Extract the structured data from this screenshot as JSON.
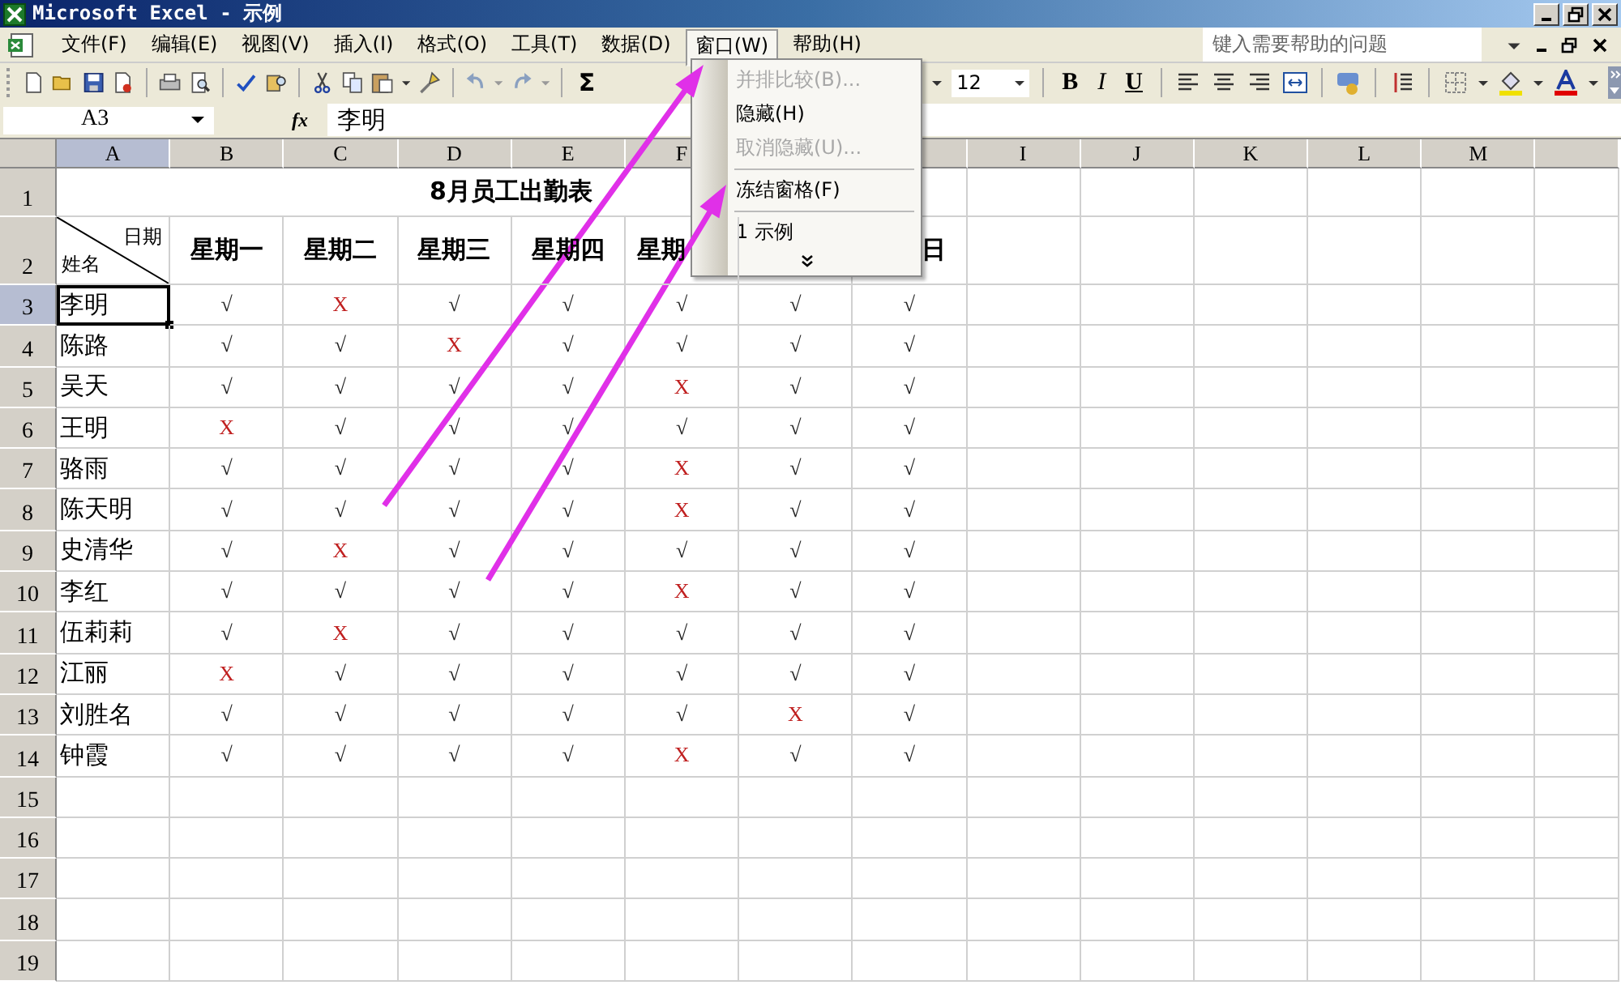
{
  "window": {
    "title": "Microsoft Excel - 示例"
  },
  "menu_bar": [
    {
      "label": "文件(F)",
      "selected": false
    },
    {
      "label": "编辑(E)",
      "selected": false
    },
    {
      "label": "视图(V)",
      "selected": false
    },
    {
      "label": "插入(I)",
      "selected": false
    },
    {
      "label": "格式(O)",
      "selected": false
    },
    {
      "label": "工具(T)",
      "selected": false
    },
    {
      "label": "数据(D)",
      "selected": false
    },
    {
      "label": "窗口(W)",
      "selected": true
    },
    {
      "label": "帮助(H)",
      "selected": false
    }
  ],
  "help_box": {
    "placeholder": "键入需要帮助的问题"
  },
  "toolbar": {
    "sum": "Σ",
    "font_size": "12",
    "bold": "B",
    "italic": "I",
    "underline": "U"
  },
  "formula_bar": {
    "name_box": "A3",
    "fx": "fx",
    "value": "李明"
  },
  "window_menu": [
    {
      "kind": "item",
      "label": "并排比较(B)...",
      "disabled": true
    },
    {
      "kind": "item",
      "label": "隐藏(H)",
      "disabled": false
    },
    {
      "kind": "item",
      "label": "取消隐藏(U)...",
      "disabled": true
    },
    {
      "kind": "separator"
    },
    {
      "kind": "item",
      "label": "冻结窗格(F)",
      "disabled": false
    },
    {
      "kind": "separator"
    },
    {
      "kind": "item",
      "label": "1 示例",
      "disabled": false
    },
    {
      "kind": "expand"
    }
  ],
  "column_headers_left": [
    {
      "label": "A",
      "selected": true
    },
    {
      "label": "B",
      "selected": false
    },
    {
      "label": "C",
      "selected": false
    },
    {
      "label": "D",
      "selected": false
    },
    {
      "label": "E",
      "selected": false
    },
    {
      "label": "F",
      "selected": false
    }
  ],
  "column_headers_right": [
    {
      "label": "I",
      "selected": false
    },
    {
      "label": "J",
      "selected": false
    },
    {
      "label": "K",
      "selected": false
    },
    {
      "label": "L",
      "selected": false
    },
    {
      "label": "M",
      "selected": false
    }
  ],
  "row_headers": [
    {
      "label": "1",
      "selected": false
    },
    {
      "label": "2",
      "selected": false
    },
    {
      "label": "3",
      "selected": true
    },
    {
      "label": "4",
      "selected": false
    },
    {
      "label": "5",
      "selected": false
    },
    {
      "label": "6",
      "selected": false
    },
    {
      "label": "7",
      "selected": false
    },
    {
      "label": "8",
      "selected": false
    },
    {
      "label": "9",
      "selected": false
    },
    {
      "label": "10",
      "selected": false
    },
    {
      "label": "11",
      "selected": false
    },
    {
      "label": "12",
      "selected": false
    },
    {
      "label": "13",
      "selected": false
    },
    {
      "label": "14",
      "selected": false
    },
    {
      "label": "15",
      "selected": false
    },
    {
      "label": "16",
      "selected": false
    },
    {
      "label": "17",
      "selected": false
    },
    {
      "label": "18",
      "selected": false
    },
    {
      "label": "19",
      "selected": false
    }
  ],
  "sheet": {
    "title": "8月员工出勤表",
    "corner_top": "日期",
    "corner_bottom": "姓名",
    "day_headers": [
      {
        "text": "星期一",
        "kind": "full"
      },
      {
        "text": "星期二",
        "kind": "full"
      },
      {
        "text": "星期三",
        "kind": "full"
      },
      {
        "text": "星期四",
        "kind": "full"
      },
      {
        "text": "星期",
        "kind": "cut_end"
      },
      {
        "kind": "hidden"
      },
      {
        "text": "日",
        "kind": "cut_start"
      }
    ],
    "rows": [
      {
        "name": "李明",
        "selected": true,
        "marks": [
          {
            "text": "√",
            "kind": "present"
          },
          {
            "text": "X",
            "kind": "absent"
          },
          {
            "text": "√",
            "kind": "present"
          },
          {
            "text": "√",
            "kind": "present"
          },
          {
            "text": "√",
            "kind": "present"
          },
          {
            "text": "√",
            "kind": "present"
          },
          {
            "text": "√",
            "kind": "present"
          }
        ]
      },
      {
        "name": "陈路",
        "selected": false,
        "marks": [
          {
            "text": "√",
            "kind": "present"
          },
          {
            "text": "√",
            "kind": "present"
          },
          {
            "text": "X",
            "kind": "absent"
          },
          {
            "text": "√",
            "kind": "present"
          },
          {
            "text": "√",
            "kind": "present"
          },
          {
            "text": "√",
            "kind": "present"
          },
          {
            "text": "√",
            "kind": "present"
          }
        ]
      },
      {
        "name": "吴天",
        "selected": false,
        "marks": [
          {
            "text": "√",
            "kind": "present"
          },
          {
            "text": "√",
            "kind": "present"
          },
          {
            "text": "√",
            "kind": "present"
          },
          {
            "text": "√",
            "kind": "present"
          },
          {
            "text": "X",
            "kind": "absent"
          },
          {
            "text": "√",
            "kind": "present"
          },
          {
            "text": "√",
            "kind": "present"
          }
        ]
      },
      {
        "name": "王明",
        "selected": false,
        "marks": [
          {
            "text": "X",
            "kind": "absent"
          },
          {
            "text": "√",
            "kind": "present"
          },
          {
            "text": "√",
            "kind": "present"
          },
          {
            "text": "√",
            "kind": "present"
          },
          {
            "text": "√",
            "kind": "present"
          },
          {
            "text": "√",
            "kind": "present"
          },
          {
            "text": "√",
            "kind": "present"
          }
        ]
      },
      {
        "name": "骆雨",
        "selected": false,
        "marks": [
          {
            "text": "√",
            "kind": "present"
          },
          {
            "text": "√",
            "kind": "present"
          },
          {
            "text": "√",
            "kind": "present"
          },
          {
            "text": "√",
            "kind": "present"
          },
          {
            "text": "X",
            "kind": "absent"
          },
          {
            "text": "√",
            "kind": "present"
          },
          {
            "text": "√",
            "kind": "present"
          }
        ]
      },
      {
        "name": "陈天明",
        "selected": false,
        "marks": [
          {
            "text": "√",
            "kind": "present"
          },
          {
            "text": "√",
            "kind": "present"
          },
          {
            "text": "√",
            "kind": "present"
          },
          {
            "text": "√",
            "kind": "present"
          },
          {
            "text": "X",
            "kind": "absent"
          },
          {
            "text": "√",
            "kind": "present"
          },
          {
            "text": "√",
            "kind": "present"
          }
        ]
      },
      {
        "name": "史清华",
        "selected": false,
        "marks": [
          {
            "text": "√",
            "kind": "present"
          },
          {
            "text": "X",
            "kind": "absent"
          },
          {
            "text": "√",
            "kind": "present"
          },
          {
            "text": "√",
            "kind": "present"
          },
          {
            "text": "√",
            "kind": "present"
          },
          {
            "text": "√",
            "kind": "present"
          },
          {
            "text": "√",
            "kind": "present"
          }
        ]
      },
      {
        "name": "李红",
        "selected": false,
        "marks": [
          {
            "text": "√",
            "kind": "present"
          },
          {
            "text": "√",
            "kind": "present"
          },
          {
            "text": "√",
            "kind": "present"
          },
          {
            "text": "√",
            "kind": "present"
          },
          {
            "text": "X",
            "kind": "absent"
          },
          {
            "text": "√",
            "kind": "present"
          },
          {
            "text": "√",
            "kind": "present"
          }
        ]
      },
      {
        "name": "伍莉莉",
        "selected": false,
        "marks": [
          {
            "text": "√",
            "kind": "present"
          },
          {
            "text": "X",
            "kind": "absent"
          },
          {
            "text": "√",
            "kind": "present"
          },
          {
            "text": "√",
            "kind": "present"
          },
          {
            "text": "√",
            "kind": "present"
          },
          {
            "text": "√",
            "kind": "present"
          },
          {
            "text": "√",
            "kind": "present"
          }
        ]
      },
      {
        "name": "江丽",
        "selected": false,
        "marks": [
          {
            "text": "X",
            "kind": "absent"
          },
          {
            "text": "√",
            "kind": "present"
          },
          {
            "text": "√",
            "kind": "present"
          },
          {
            "text": "√",
            "kind": "present"
          },
          {
            "text": "√",
            "kind": "present"
          },
          {
            "text": "√",
            "kind": "present"
          },
          {
            "text": "√",
            "kind": "present"
          }
        ]
      },
      {
        "name": "刘胜名",
        "selected": false,
        "marks": [
          {
            "text": "√",
            "kind": "present"
          },
          {
            "text": "√",
            "kind": "present"
          },
          {
            "text": "√",
            "kind": "present"
          },
          {
            "text": "√",
            "kind": "present"
          },
          {
            "text": "√",
            "kind": "present"
          },
          {
            "text": "X",
            "kind": "absent"
          },
          {
            "text": "√",
            "kind": "present"
          }
        ]
      },
      {
        "name": "钟霞",
        "selected": false,
        "marks": [
          {
            "text": "√",
            "kind": "present"
          },
          {
            "text": "√",
            "kind": "present"
          },
          {
            "text": "√",
            "kind": "present"
          },
          {
            "text": "√",
            "kind": "present"
          },
          {
            "text": "X",
            "kind": "absent"
          },
          {
            "text": "√",
            "kind": "present"
          },
          {
            "text": "√",
            "kind": "present"
          }
        ]
      }
    ]
  }
}
